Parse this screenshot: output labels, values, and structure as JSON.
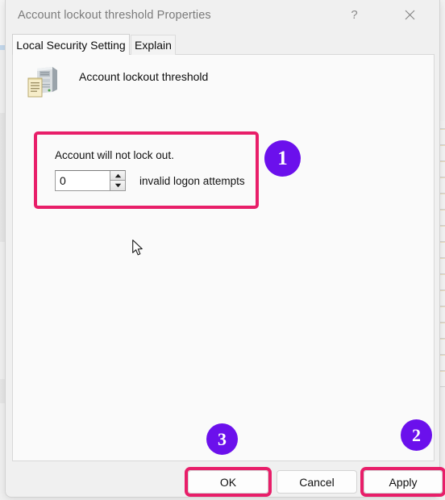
{
  "window": {
    "title": "Account lockout threshold Properties",
    "help_icon": "help-question-icon",
    "help_glyph": "?",
    "close_icon": "close-x-icon"
  },
  "tabs": [
    {
      "label": "Local Security Setting",
      "active": true
    },
    {
      "label": "Explain",
      "active": false
    }
  ],
  "content": {
    "policy_icon": "policy-computer-document-icon",
    "policy_name": "Account lockout threshold",
    "setting": {
      "status_label": "Account will not lock out.",
      "threshold_value": "0",
      "threshold_placeholder": "0",
      "unit_label": "invalid logon attempts",
      "spinner_up_icon": "spinner-up-arrow-icon",
      "spinner_down_icon": "spinner-down-arrow-icon"
    }
  },
  "cursor": {
    "icon": "mouse-pointer-arrow-icon"
  },
  "footer": {
    "ok_label": "OK",
    "cancel_label": "Cancel",
    "apply_label": "Apply"
  },
  "annotations": {
    "highlight_color": "#e81e69",
    "badge_color": "#6b10ec",
    "badges": [
      {
        "number": "1",
        "target": "setting-group"
      },
      {
        "number": "2",
        "target": "apply-button"
      },
      {
        "number": "3",
        "target": "ok-button"
      }
    ]
  }
}
